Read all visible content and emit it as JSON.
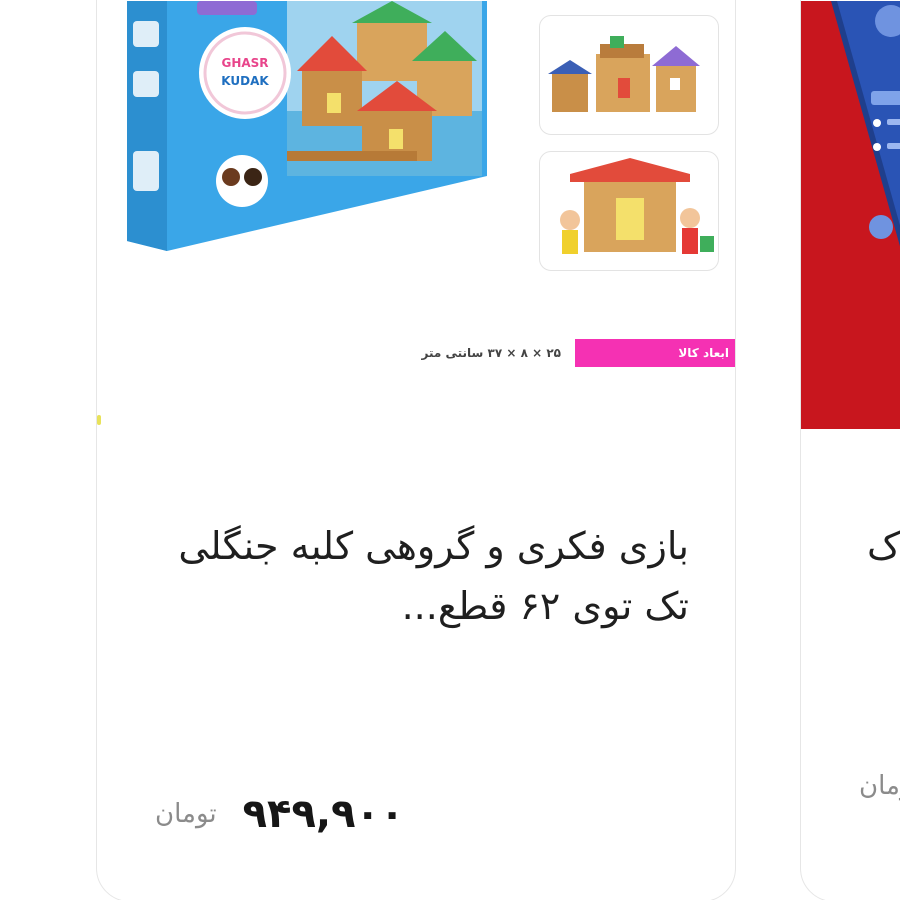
{
  "products": [
    {
      "box_logo_text": "GHASR KUDAK",
      "spec_label": "ابعاد کالا",
      "spec_value": "۲۵ × ۸ × ۳۷ سانتی متر",
      "title": "بازی فکری و گروهی کلبه جنگلی تک توی ۶۲ قطع...",
      "price": "۹۴۹,۹۰۰",
      "currency": "تومان"
    },
    {
      "title_partial": "ک",
      "currency": "تومان"
    }
  ],
  "colors": {
    "spec_label_bg": "#f531b3",
    "box_blue": "#3aa6e8",
    "next_card_bg": "#c8161e",
    "price_text": "#161616",
    "currency_text": "#8b8b8b"
  },
  "icons": {
    "currency": "toman-symbol"
  }
}
